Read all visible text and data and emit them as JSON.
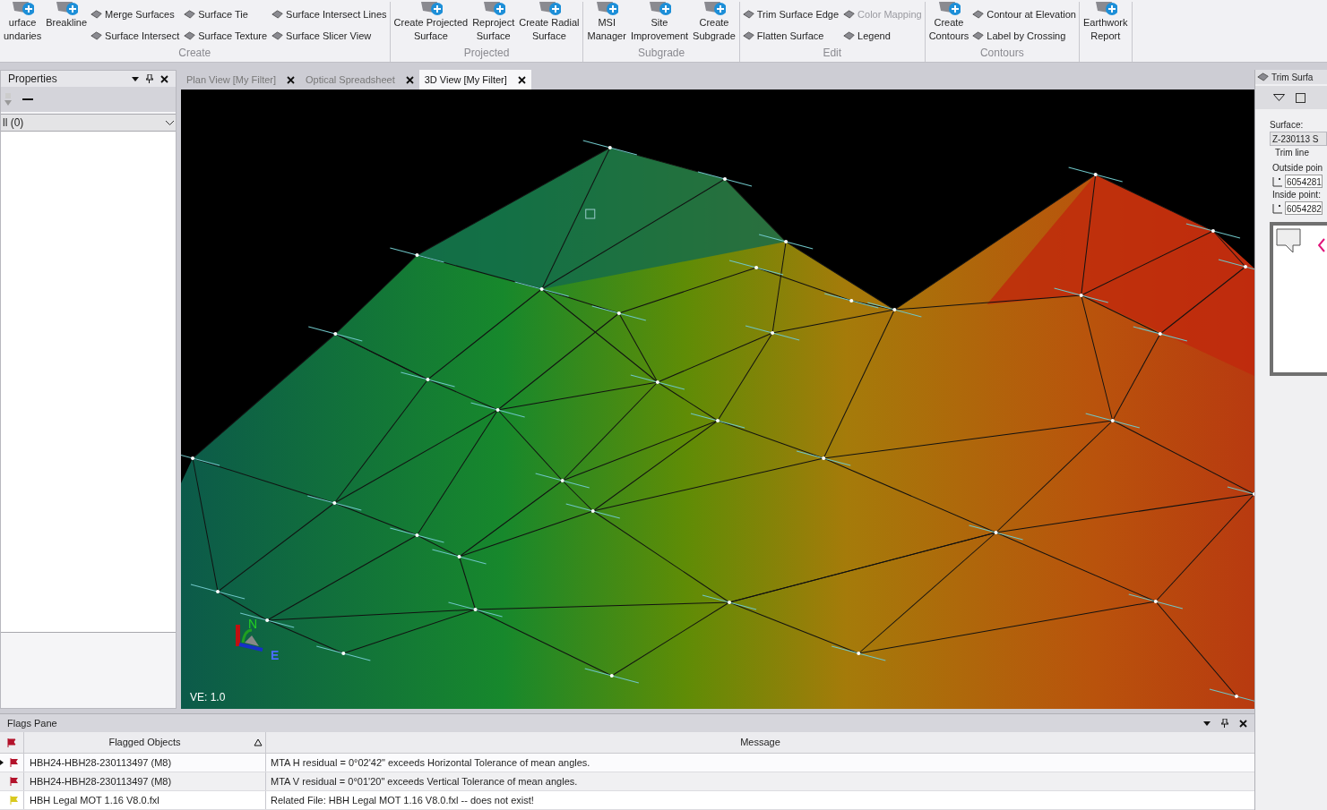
{
  "ribbon": {
    "groups": [
      {
        "label": "Create",
        "items": [
          {
            "kind": "large",
            "lines": [
              "urface",
              "undaries"
            ],
            "disabled": false
          },
          {
            "kind": "large",
            "lines": [
              "Breakline"
            ],
            "disabled": false
          },
          {
            "kind": "small",
            "lines": [
              "Merge Surfaces"
            ],
            "disabled": false
          },
          {
            "kind": "small",
            "lines": [
              "Surface Intersect"
            ],
            "disabled": false
          },
          {
            "kind": "small",
            "lines": [
              "Surface Tie"
            ],
            "disabled": false
          },
          {
            "kind": "small",
            "lines": [
              "Surface Texture"
            ],
            "disabled": false
          },
          {
            "kind": "small",
            "lines": [
              "Surface Intersect Lines"
            ],
            "disabled": false
          },
          {
            "kind": "small",
            "lines": [
              "Surface Slicer View"
            ],
            "disabled": false
          }
        ]
      },
      {
        "label": "Projected",
        "items": [
          {
            "kind": "large",
            "lines": [
              "Create Projected",
              "Surface"
            ],
            "disabled": false
          },
          {
            "kind": "large",
            "lines": [
              "Reproject",
              "Surface"
            ],
            "disabled": false
          },
          {
            "kind": "large",
            "lines": [
              "Create Radial",
              "Surface"
            ],
            "disabled": false
          }
        ]
      },
      {
        "label": "Subgrade",
        "items": [
          {
            "kind": "large",
            "lines": [
              "MSI",
              "Manager"
            ],
            "disabled": false
          },
          {
            "kind": "large",
            "lines": [
              "Site",
              "Improvement"
            ],
            "disabled": false
          },
          {
            "kind": "large",
            "lines": [
              "Create",
              "Subgrade"
            ],
            "disabled": false
          }
        ]
      },
      {
        "label": "Edit",
        "items": [
          {
            "kind": "small",
            "lines": [
              "Trim Surface Edge"
            ],
            "disabled": false
          },
          {
            "kind": "small",
            "lines": [
              "Flatten Surface"
            ],
            "disabled": false
          },
          {
            "kind": "small",
            "lines": [
              "Color Mapping"
            ],
            "disabled": true
          },
          {
            "kind": "small",
            "lines": [
              "Legend"
            ],
            "disabled": false
          }
        ]
      },
      {
        "label": "Contours",
        "items": [
          {
            "kind": "large",
            "lines": [
              "Create",
              "Contours"
            ],
            "disabled": false
          },
          {
            "kind": "small",
            "lines": [
              "Contour at Elevation"
            ],
            "disabled": false
          },
          {
            "kind": "small",
            "lines": [
              "Label by Crossing"
            ],
            "disabled": false
          }
        ]
      },
      {
        "items": [
          {
            "kind": "large",
            "lines": [
              "Earthwork",
              "Report"
            ],
            "disabled": false
          }
        ]
      }
    ]
  },
  "properties": {
    "title": "Properties",
    "filter": "ll (0)"
  },
  "doc_tabs": [
    {
      "label": "Plan View [My Filter]",
      "selected": false
    },
    {
      "label": "Optical Spreadsheet",
      "selected": false
    },
    {
      "label": "3D View [My Filter]",
      "selected": true
    }
  ],
  "view": {
    "ve": "VE: 1.0",
    "axis_n": "N",
    "axis_e": "E"
  },
  "trim_panel": {
    "title": "Trim Surfa",
    "surface_label": "Surface:",
    "surface": "Z-230113 S",
    "group": "Trim line",
    "outside_label": "Outside poin",
    "outside": "6054281",
    "inside_label": "Inside point:",
    "inside": "6054282"
  },
  "flags": {
    "title": "Flags Pane",
    "columns": [
      "Flagged Objects",
      "Message"
    ],
    "rows": [
      {
        "color": "#b3122b",
        "object": "HBH24-HBH28-230113497 (M8)",
        "message": "MTA H residual = 0°02'42\" exceeds Horizontal Tolerance of mean angles.",
        "selected": true
      },
      {
        "color": "#b3122b",
        "object": "HBH24-HBH28-230113497 (M8)",
        "message": "MTA V residual = 0°01'20\" exceeds Vertical Tolerance of mean angles.",
        "selected": false
      },
      {
        "color": "#d9c91f",
        "object": "HBH Legal MOT 1.16 V8.0.fxl",
        "message": "Related File: HBH Legal MOT 1.16 V8.0.fxl -- does not exist!",
        "selected": false
      }
    ]
  }
}
